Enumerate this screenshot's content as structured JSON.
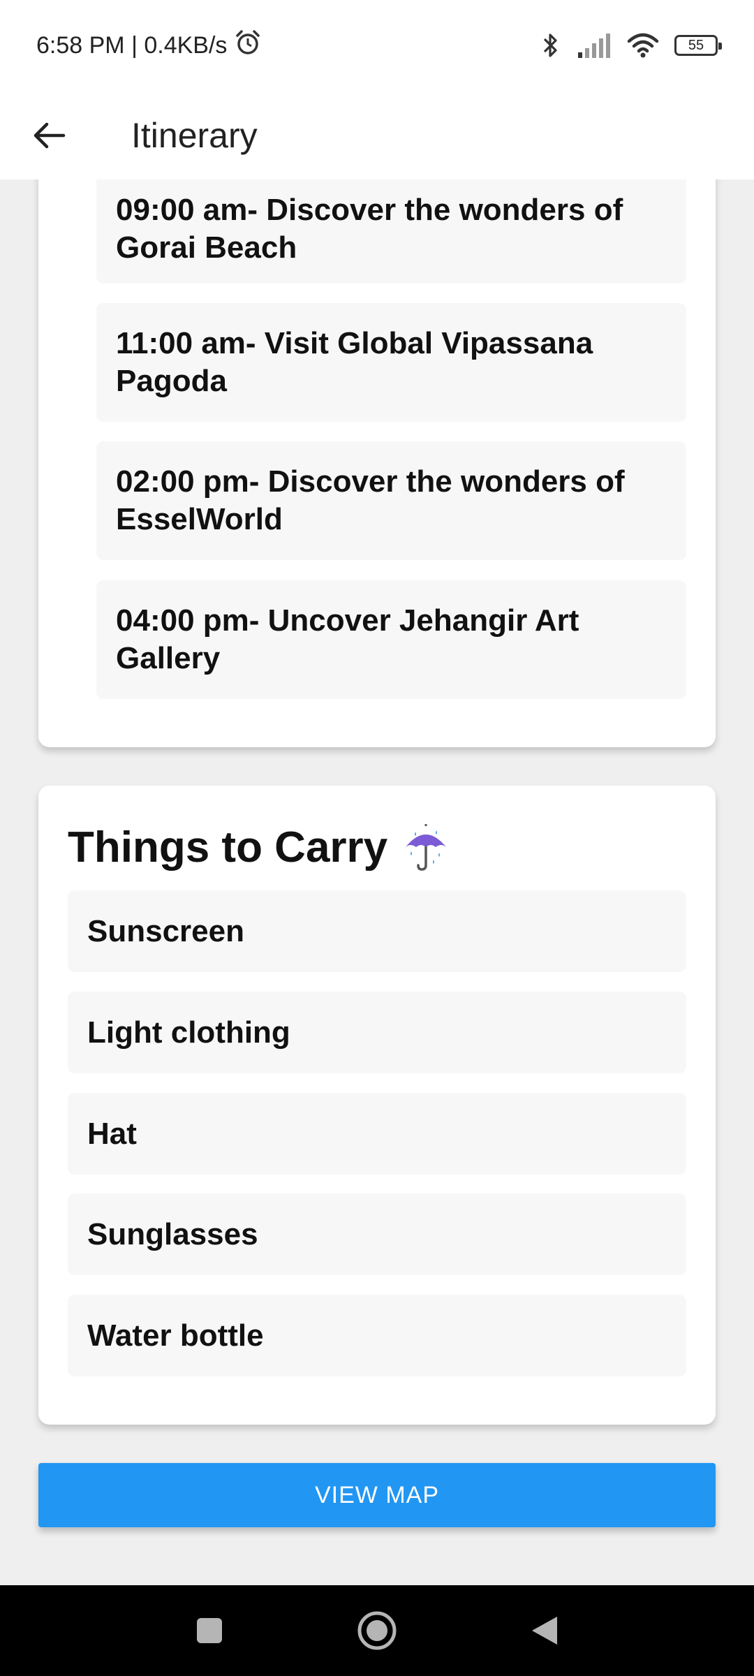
{
  "status_bar": {
    "time_speed": "6:58 PM | 0.4KB/s",
    "battery_level": "55",
    "icons": [
      "alarm-icon",
      "bluetooth-icon",
      "signal-icon",
      "wifi-icon",
      "battery-icon"
    ]
  },
  "app_bar": {
    "title": "Itinerary",
    "back_icon": "arrow-back-icon"
  },
  "itinerary": {
    "items": [
      "09:00 am- Discover the wonders of Gorai Beach",
      "11:00 am- Visit Global Vipassana Pagoda",
      "02:00 pm- Discover the wonders of EsselWorld",
      "04:00 pm- Uncover Jehangir Art Gallery"
    ]
  },
  "things_to_carry": {
    "heading": "Things to Carry",
    "heading_emoji": "umbrella-with-rain-icon",
    "items": [
      "Sunscreen",
      "Light clothing",
      "Hat",
      "Sunglasses",
      "Water bottle"
    ]
  },
  "actions": {
    "view_map_label": "VIEW MAP"
  },
  "colors": {
    "accent": "#2196f3",
    "background": "#efefef",
    "card": "#ffffff",
    "item_bg": "#f7f7f7"
  },
  "nav_bar": {
    "icons": [
      "recents-square-icon",
      "home-circle-icon",
      "back-triangle-icon"
    ]
  }
}
